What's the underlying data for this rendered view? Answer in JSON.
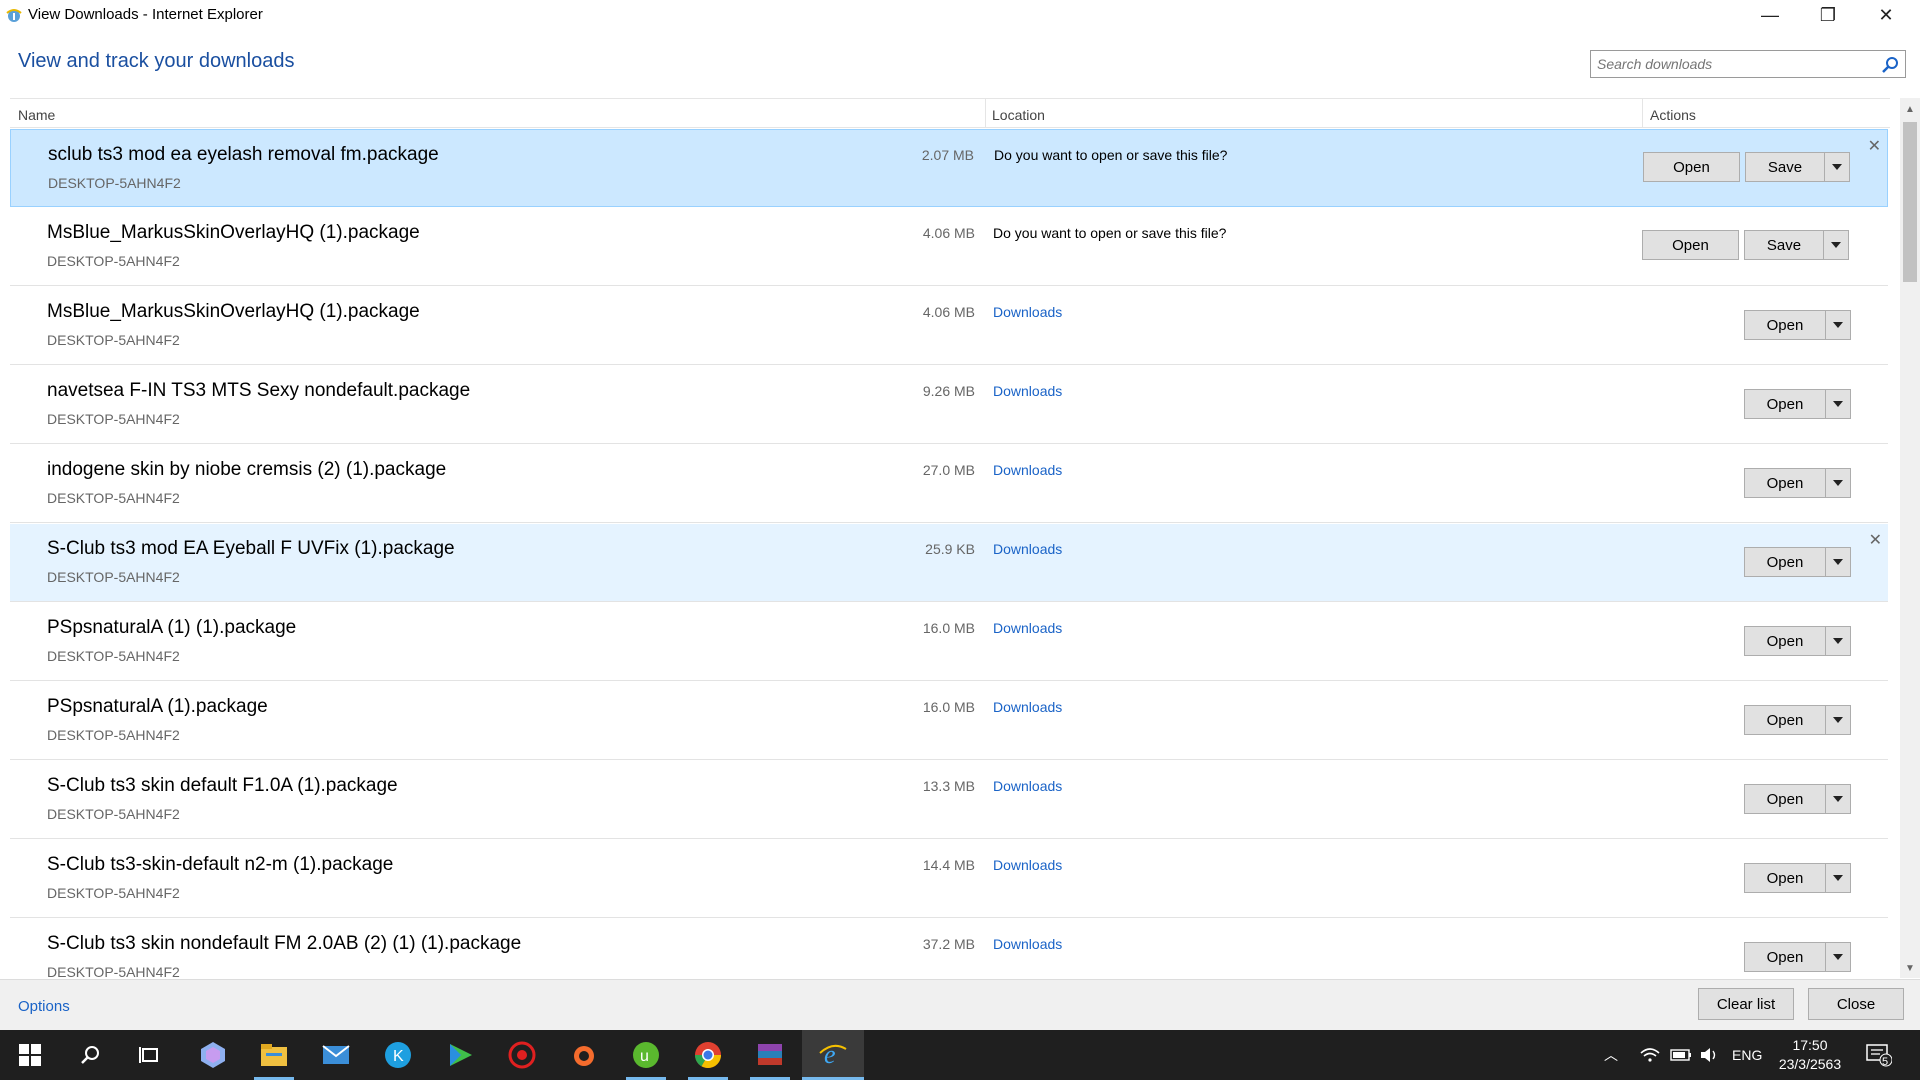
{
  "window": {
    "title": "View Downloads - Internet Explorer",
    "minimize_glyph": "—",
    "maximize_glyph": "❐",
    "close_glyph": "✕"
  },
  "header": {
    "heading": "View and track your downloads",
    "search_placeholder": "Search downloads"
  },
  "columns": {
    "name": "Name",
    "location": "Location",
    "actions": "Actions"
  },
  "downloads": [
    {
      "name": "sclub ts3 mod ea eyelash removal fm.package",
      "host": "DESKTOP-5AHN4F2",
      "size": "2.07 MB",
      "location": "Do you want to open or save this file?",
      "type": "prompt",
      "state": "selected",
      "open": "Open",
      "save": "Save"
    },
    {
      "name": "MsBlue_MarkusSkinOverlayHQ (1).package",
      "host": "DESKTOP-5AHN4F2",
      "size": "4.06 MB",
      "location": "Do you want to open or save this file?",
      "type": "prompt",
      "state": "normal",
      "open": "Open",
      "save": "Save"
    },
    {
      "name": "MsBlue_MarkusSkinOverlayHQ (1).package",
      "host": "DESKTOP-5AHN4F2",
      "size": "4.06 MB",
      "location": "Downloads",
      "type": "done",
      "state": "normal",
      "open": "Open"
    },
    {
      "name": "navetsea F-IN TS3 MTS Sexy nondefault.package",
      "host": "DESKTOP-5AHN4F2",
      "size": "9.26 MB",
      "location": "Downloads",
      "type": "done",
      "state": "normal",
      "open": "Open"
    },
    {
      "name": "indogene skin by niobe cremsis (2) (1).package",
      "host": "DESKTOP-5AHN4F2",
      "size": "27.0 MB",
      "location": "Downloads",
      "type": "done",
      "state": "normal",
      "open": "Open"
    },
    {
      "name": "S-Club ts3 mod EA Eyeball F UVFix (1).package",
      "host": "DESKTOP-5AHN4F2",
      "size": "25.9 KB",
      "location": "Downloads",
      "type": "done",
      "state": "hover",
      "open": "Open"
    },
    {
      "name": "PSpsnaturalA (1) (1).package",
      "host": "DESKTOP-5AHN4F2",
      "size": "16.0 MB",
      "location": "Downloads",
      "type": "done",
      "state": "normal",
      "open": "Open"
    },
    {
      "name": "PSpsnaturalA (1).package",
      "host": "DESKTOP-5AHN4F2",
      "size": "16.0 MB",
      "location": "Downloads",
      "type": "done",
      "state": "normal",
      "open": "Open"
    },
    {
      "name": "S-Club ts3 skin default F1.0A (1).package",
      "host": "DESKTOP-5AHN4F2",
      "size": "13.3 MB",
      "location": "Downloads",
      "type": "done",
      "state": "normal",
      "open": "Open"
    },
    {
      "name": "S-Club ts3-skin-default n2-m (1).package",
      "host": "DESKTOP-5AHN4F2",
      "size": "14.4 MB",
      "location": "Downloads",
      "type": "done",
      "state": "normal",
      "open": "Open"
    },
    {
      "name": "S-Club ts3 skin nondefault  FM 2.0AB (2) (1) (1).package",
      "host": "DESKTOP-5AHN4F2",
      "size": "37.2 MB",
      "location": "Downloads",
      "type": "done",
      "state": "normal",
      "open": "Open"
    }
  ],
  "remove_glyph": "✕",
  "footer": {
    "options": "Options",
    "clear_list": "Clear list",
    "close": "Close"
  },
  "taskbar": {
    "apps": [
      "windows-start-icon",
      "search-icon",
      "task-view-icon",
      "app-icon",
      "file-explorer-icon",
      "mail-icon",
      "kodi-icon",
      "media-player-icon",
      "red-app-icon",
      "origin-icon",
      "utorrent-icon",
      "chrome-icon",
      "winrar-icon",
      "internet-explorer-icon"
    ],
    "language": "ENG",
    "time": "17:50",
    "date": "23/3/2563",
    "notification_count": "5"
  },
  "colors": {
    "accent": "#1a4fa0",
    "link": "#1a63c7",
    "selected_row": "#cce8ff",
    "hover_row": "#e5f3ff",
    "taskbar": "#1f1f1f"
  }
}
